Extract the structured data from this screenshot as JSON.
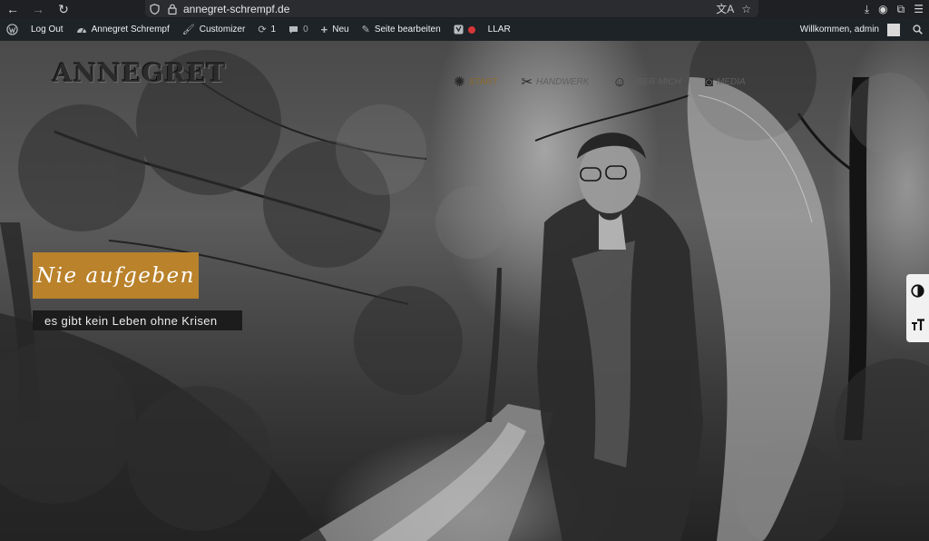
{
  "browser": {
    "url": "annegret-schrempf.de",
    "icons": {
      "back": "back-arrow-icon",
      "forward": "forward-arrow-icon",
      "reload": "reload-icon",
      "shield": "shield-icon",
      "lock": "lock-icon",
      "translate": "translate-icon",
      "bookmark": "star-icon",
      "download": "download-icon",
      "account": "account-icon",
      "extensions": "puzzle-icon",
      "menu": "menu-icon"
    }
  },
  "adminbar": {
    "logout": "Log Out",
    "site_name": "Annegret Schrempf",
    "customizer": "Customizer",
    "updates_count": "1",
    "comments_count": "0",
    "new": "Neu",
    "edit_page": "Seite bearbeiten",
    "llar": "LLAR",
    "greeting": "Willkommen, admin",
    "colors": {
      "bar_bg": "#1d2327",
      "llar_dot": "#d63638"
    }
  },
  "site": {
    "logo": "ANNEGRET",
    "nav": [
      {
        "label": "START",
        "icon": "sun-icon",
        "active": true
      },
      {
        "label": "HANDWERK",
        "icon": "scissors-icon",
        "active": false
      },
      {
        "label": "ÜBER MICH",
        "icon": "person-icon",
        "active": false
      },
      {
        "label": "MEDIA",
        "icon": "camera-icon",
        "active": false
      }
    ]
  },
  "hero": {
    "title": "Nie aufgeben",
    "subtitle": "es gibt kein Leben ohne Krisen",
    "accent_color": "#b9822b"
  },
  "accessibility": {
    "contrast": "contrast-icon",
    "font_size": "font-size-icon"
  }
}
